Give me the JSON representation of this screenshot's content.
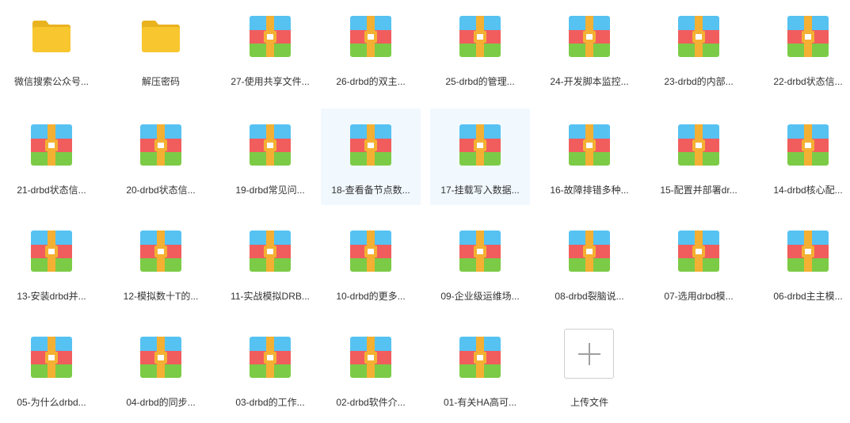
{
  "items": [
    {
      "label": "微信搜索公众号...",
      "kind": "folder",
      "selected": false
    },
    {
      "label": "解压密码",
      "kind": "folder",
      "selected": false
    },
    {
      "label": "27-使用共享文件...",
      "kind": "archive",
      "selected": false
    },
    {
      "label": "26-drbd的双主...",
      "kind": "archive",
      "selected": false
    },
    {
      "label": "25-drbd的管理...",
      "kind": "archive",
      "selected": false
    },
    {
      "label": "24-开发脚本监控...",
      "kind": "archive",
      "selected": false
    },
    {
      "label": "23-drbd的内部...",
      "kind": "archive",
      "selected": false
    },
    {
      "label": "22-drbd状态信...",
      "kind": "archive",
      "selected": false
    },
    {
      "label": "21-drbd状态信...",
      "kind": "archive",
      "selected": false
    },
    {
      "label": "20-drbd状态信...",
      "kind": "archive",
      "selected": false
    },
    {
      "label": "19-drbd常见问...",
      "kind": "archive",
      "selected": false
    },
    {
      "label": "18-查看备节点数...",
      "kind": "archive",
      "selected": true
    },
    {
      "label": "17-挂载写入数据...",
      "kind": "archive",
      "selected": true
    },
    {
      "label": "16-故障排错多种...",
      "kind": "archive",
      "selected": false
    },
    {
      "label": "15-配置并部署dr...",
      "kind": "archive",
      "selected": false
    },
    {
      "label": "14-drbd核心配...",
      "kind": "archive",
      "selected": false
    },
    {
      "label": "13-安装drbd并...",
      "kind": "archive",
      "selected": false
    },
    {
      "label": "12-模拟数十T的...",
      "kind": "archive",
      "selected": false
    },
    {
      "label": "11-实战模拟DRB...",
      "kind": "archive",
      "selected": false
    },
    {
      "label": "10-drbd的更多...",
      "kind": "archive",
      "selected": false
    },
    {
      "label": "09-企业级运维场...",
      "kind": "archive",
      "selected": false
    },
    {
      "label": "08-drbd裂脑说...",
      "kind": "archive",
      "selected": false
    },
    {
      "label": "07-选用drbd模...",
      "kind": "archive",
      "selected": false
    },
    {
      "label": "06-drbd主主模...",
      "kind": "archive",
      "selected": false
    },
    {
      "label": "05-为什么drbd...",
      "kind": "archive",
      "selected": false
    },
    {
      "label": "04-drbd的同步...",
      "kind": "archive",
      "selected": false
    },
    {
      "label": "03-drbd的工作...",
      "kind": "archive",
      "selected": false
    },
    {
      "label": "02-drbd软件介...",
      "kind": "archive",
      "selected": false
    },
    {
      "label": "01-有关HA高可...",
      "kind": "archive",
      "selected": false
    },
    {
      "label": "上传文件",
      "kind": "upload",
      "selected": false
    }
  ],
  "colors": {
    "folder": "#f8c62e",
    "folder_tab": "#e9b320",
    "archive_top": "#56c2f1",
    "archive_mid": "#f15d5d",
    "archive_bottom": "#7ccb46",
    "archive_strap": "#f4b032",
    "selected_bg": "#f1f8fe",
    "text": "#333333"
  },
  "icons": {
    "folder": "folder-icon",
    "archive": "archive-file-icon",
    "upload": "plus-icon"
  }
}
